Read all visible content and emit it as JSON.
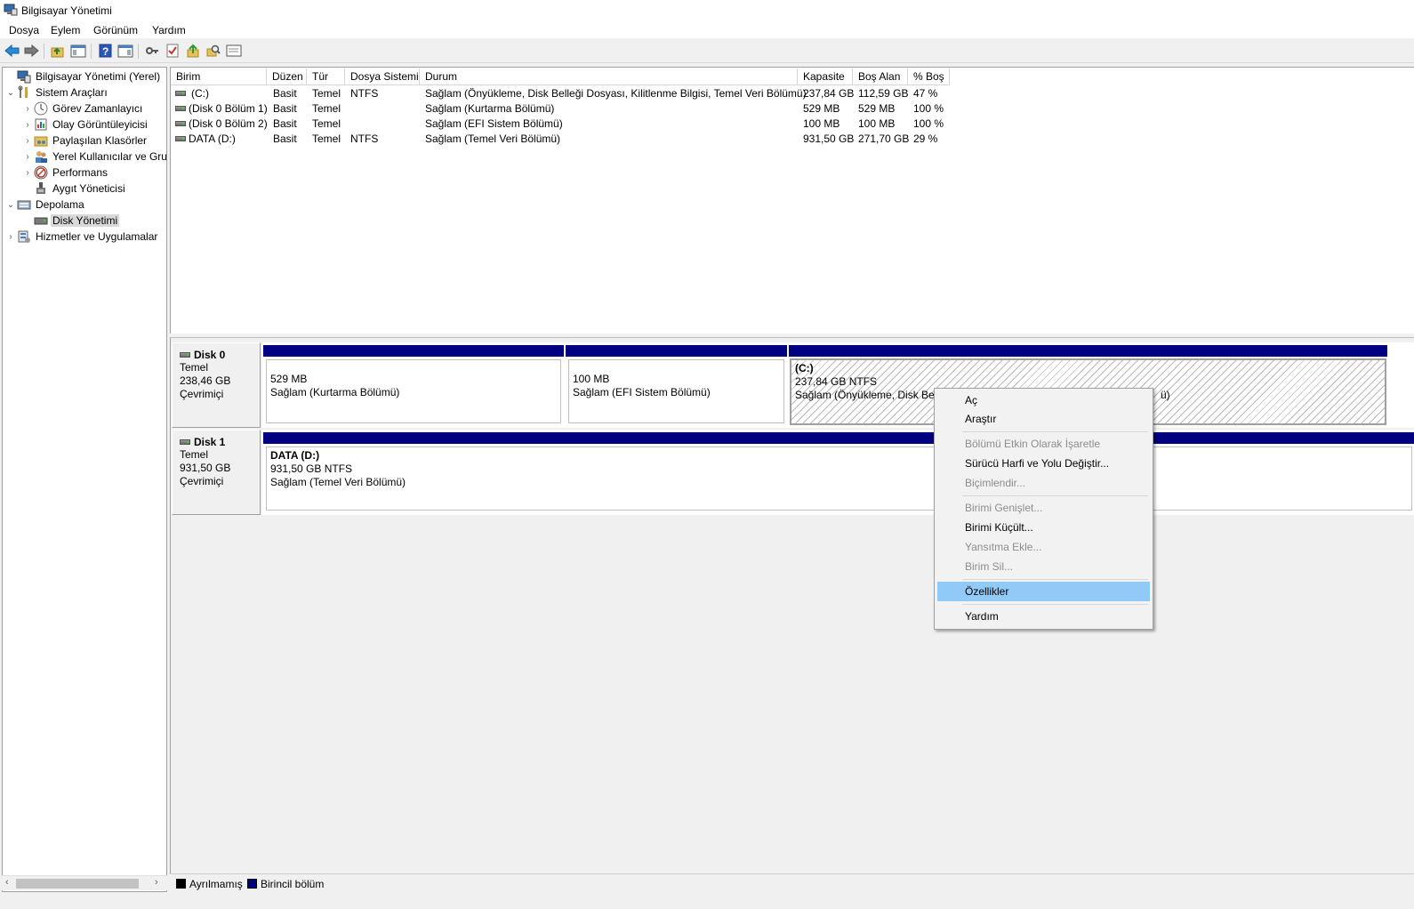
{
  "window": {
    "title": "Bilgisayar Yönetimi"
  },
  "menubar": [
    "Dosya",
    "Eylem",
    "Görünüm",
    "Yardım"
  ],
  "tree": {
    "root": "Bilgisayar Yönetimi (Yerel)",
    "system_tools": "Sistem Araçları",
    "task_scheduler": "Görev Zamanlayıcı",
    "event_viewer": "Olay Görüntüleyicisi",
    "shared_folders": "Paylaşılan Klasörler",
    "local_users": "Yerel Kullanıcılar ve Gru",
    "performance": "Performans",
    "device_manager": "Aygıt Yöneticisi",
    "storage": "Depolama",
    "disk_management": "Disk Yönetimi",
    "services": "Hizmetler ve Uygulamalar"
  },
  "volume_list": {
    "columns": [
      "Birim",
      "Düzen",
      "Tür",
      "Dosya Sistemi",
      "Durum",
      "Kapasite",
      "Boş Alan",
      "% Boş"
    ],
    "rows": [
      [
        "(C:)",
        "Basit",
        "Temel",
        "NTFS",
        "Sağlam (Önyükleme, Disk Belleği Dosyası, Kilitlenme Bilgisi, Temel Veri Bölümü)",
        "237,84 GB",
        "112,59 GB",
        "47 %"
      ],
      [
        "(Disk 0 Bölüm 1)",
        "Basit",
        "Temel",
        "",
        "Sağlam (Kurtarma Bölümü)",
        "529 MB",
        "529 MB",
        "100 %"
      ],
      [
        "(Disk 0 Bölüm 2)",
        "Basit",
        "Temel",
        "",
        "Sağlam (EFI Sistem Bölümü)",
        "100 MB",
        "100 MB",
        "100 %"
      ],
      [
        "DATA (D:)",
        "Basit",
        "Temel",
        "NTFS",
        "Sağlam (Temel Veri Bölümü)",
        "931,50 GB",
        "271,70 GB",
        "29 %"
      ]
    ]
  },
  "disks": {
    "disk0": {
      "name": "Disk 0",
      "type": "Temel",
      "size": "238,46 GB",
      "status": "Çevrimiçi",
      "p1": {
        "size": "529 MB",
        "status": "Sağlam (Kurtarma Bölümü)"
      },
      "p2": {
        "size": "100 MB",
        "status": "Sağlam (EFI Sistem Bölümü)"
      },
      "p3": {
        "name": "(C:)",
        "size": "237,84 GB NTFS",
        "status": "Sağlam (Önyükleme, Disk Belle",
        "status_tail": "ü)"
      }
    },
    "disk1": {
      "name": "Disk 1",
      "type": "Temel",
      "size": "931,50 GB",
      "status": "Çevrimiçi",
      "p1": {
        "name": "DATA  (D:)",
        "size": "931,50 GB NTFS",
        "status": "Sağlam (Temel Veri Bölümü)"
      }
    }
  },
  "legend": {
    "unallocated": "Ayrılmamış",
    "primary": "Birincil bölüm"
  },
  "context_menu": {
    "open": "Aç",
    "explore": "Araştır",
    "mark_active": "Bölümü Etkin Olarak İşaretle",
    "change_letter": "Sürücü Harfi ve Yolu Değiştir...",
    "format": "Biçimlendir...",
    "extend": "Birimi Genişlet...",
    "shrink": "Birimi Küçült...",
    "add_mirror": "Yansıtma Ekle...",
    "delete": "Birim Sil...",
    "properties": "Özellikler",
    "help": "Yardım"
  },
  "colors": {
    "primary_partition": "#000080",
    "unallocated": "#000000",
    "menu_highlight": "#91c9f7"
  }
}
